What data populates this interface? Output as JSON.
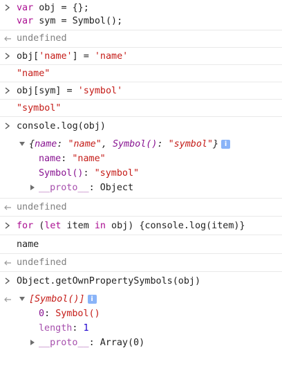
{
  "entries": [
    {
      "type": "input",
      "lines": [
        [
          {
            "t": "var",
            "c": "kw"
          },
          {
            "t": " obj = {};",
            "c": "plain"
          }
        ],
        [
          {
            "t": "var",
            "c": "kw"
          },
          {
            "t": " sym = Symbol();",
            "c": "plain"
          }
        ]
      ]
    },
    {
      "type": "result",
      "text": "undefined"
    },
    {
      "type": "input",
      "lines": [
        [
          {
            "t": "obj[",
            "c": "plain"
          },
          {
            "t": "'name'",
            "c": "str"
          },
          {
            "t": "] = ",
            "c": "plain"
          },
          {
            "t": "'name'",
            "c": "str"
          }
        ]
      ]
    },
    {
      "type": "result",
      "text": "\"name\""
    },
    {
      "type": "input",
      "lines": [
        [
          {
            "t": "obj[sym] = ",
            "c": "plain"
          },
          {
            "t": "'symbol'",
            "c": "str"
          }
        ]
      ]
    },
    {
      "type": "result",
      "text": "\"symbol\""
    },
    {
      "type": "input",
      "lines": [
        [
          {
            "t": "console.log(obj)",
            "c": "plain"
          }
        ]
      ]
    },
    {
      "type": "log-object"
    },
    {
      "type": "result",
      "text": "undefined"
    },
    {
      "type": "input",
      "lines": [
        [
          {
            "t": "for",
            "c": "kw"
          },
          {
            "t": " (",
            "c": "plain"
          },
          {
            "t": "let",
            "c": "kw"
          },
          {
            "t": " item ",
            "c": "plain"
          },
          {
            "t": "in",
            "c": "kw"
          },
          {
            "t": " obj) {console.log(item)}",
            "c": "plain"
          }
        ]
      ]
    },
    {
      "type": "log",
      "text": "name"
    },
    {
      "type": "result",
      "text": "undefined"
    },
    {
      "type": "input",
      "lines": [
        [
          {
            "t": "Object.getOwnPropertySymbols(obj)",
            "c": "plain"
          }
        ]
      ]
    },
    {
      "type": "result-array"
    }
  ],
  "log_object": {
    "preview_open": "{",
    "preview_k1": "name",
    "preview_v1": "\"name\"",
    "preview_k2": "Symbol()",
    "preview_v2": "\"symbol\"",
    "preview_close": "}",
    "info_badge": "i",
    "prop1_key": "name",
    "prop1_value": "\"name\"",
    "prop2_key": "Symbol()",
    "prop2_value": "\"symbol\"",
    "proto_key": "__proto__",
    "proto_value": "Object"
  },
  "result_array": {
    "preview": "[Symbol()]",
    "info_badge": "i",
    "idx0_key": "0",
    "idx0_value": "Symbol()",
    "length_key": "length",
    "length_value": "1",
    "proto_key": "__proto__",
    "proto_value": "Array(0)"
  },
  "colors": {
    "keyword": "#aa0d91",
    "string": "#c41a16",
    "number": "#1c00cf",
    "muted": "#808080",
    "property": "#881391"
  },
  "icons": {
    "prompt": "chevron-right-icon",
    "result": "result-arrow-icon",
    "expand": "disclosure-triangle-icon",
    "info": "info-badge-icon"
  }
}
